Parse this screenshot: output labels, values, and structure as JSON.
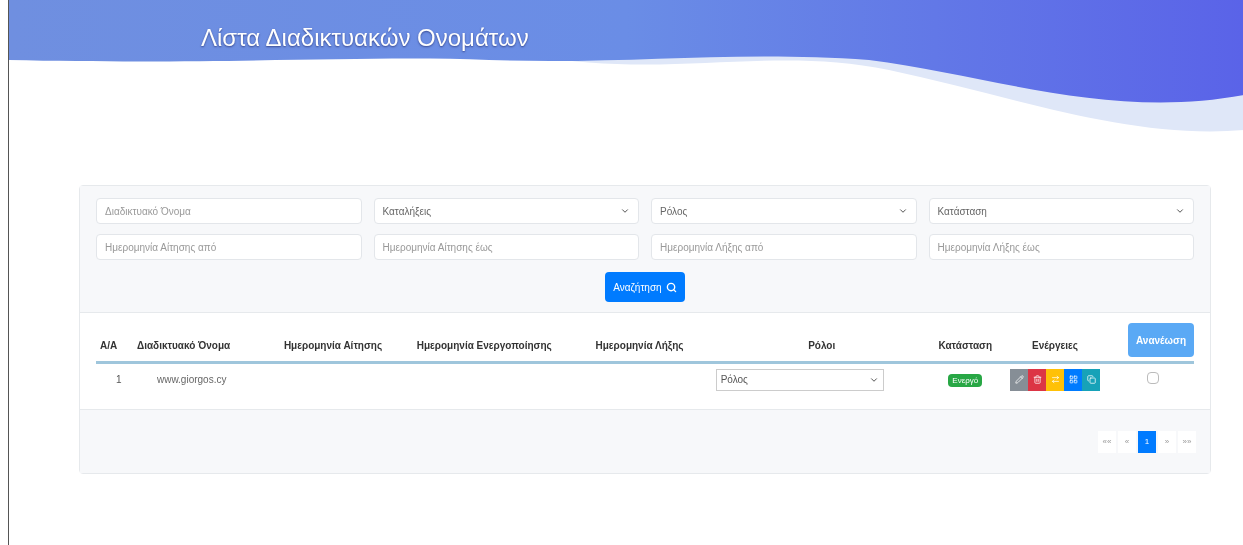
{
  "page": {
    "title": "Λίστα Διαδικτυακών Ονομάτων"
  },
  "filters": [
    {
      "kind": "text",
      "placeholder": "Διαδικτυακό Όνομα"
    },
    {
      "kind": "select",
      "value": "Καταλήξεις"
    },
    {
      "kind": "select",
      "value": "Ρόλος"
    },
    {
      "kind": "select",
      "value": "Κατάσταση"
    },
    {
      "kind": "text",
      "placeholder": "Ημερομηνία Αίτησης από"
    },
    {
      "kind": "text",
      "placeholder": "Ημερομηνία Αίτησης έως"
    },
    {
      "kind": "text",
      "placeholder": "Ημερομηνία Λήξης από"
    },
    {
      "kind": "text",
      "placeholder": "Ημερομηνία Λήξης έως"
    }
  ],
  "search_button": "Αναζήτηση",
  "table": {
    "columns": [
      "Α/Α",
      "Διαδικτυακό Όνομα",
      "Ημερομηνία Αίτησης",
      "Ημερομηνία Ενεργοποίησης",
      "Ημερομηνία Λήξης",
      "Ρόλοι",
      "Κατάσταση",
      "Ενέργειες"
    ],
    "renew_button": "Ανανέωση",
    "rows": [
      {
        "index": "1",
        "name": "www.giorgos.cy",
        "role": "Ρόλος",
        "status": "Ενεργό",
        "color": "#28a745",
        "actions": [
          {
            "kind": "edit"
          },
          {
            "kind": "delete"
          },
          {
            "kind": "transfer"
          },
          {
            "kind": "details"
          },
          {
            "kind": "copy"
          }
        ],
        "checked": false
      }
    ]
  },
  "pagination": [
    {
      "label": "««",
      "selected": false
    },
    {
      "label": "«",
      "selected": false
    },
    {
      "label": "1",
      "selected": true
    },
    {
      "label": "»",
      "selected": false
    },
    {
      "label": "»»",
      "selected": false
    }
  ]
}
